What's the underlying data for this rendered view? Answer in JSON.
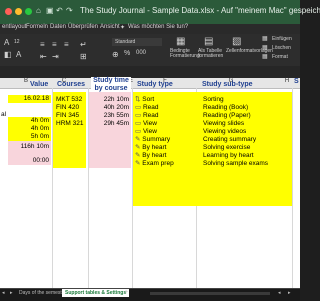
{
  "window": {
    "title": "The Study Journal - Sample Data.xlsx - Auf \"meinem Mac\" gespeichert"
  },
  "menu": [
    "entlayout",
    "Formeln",
    "Daten",
    "Überprüfen",
    "Ansicht",
    "Was möchten Sie tun?"
  ],
  "ribbon": {
    "font_size": "12",
    "number_format": "Standard",
    "conditional_label": "Bedingte Formatierung",
    "table_label": "Als Tabelle formatieren",
    "cellstyles_label": "Zellenformatvorlagen",
    "insert_label": "Einfügen",
    "delete_label": "Löschen",
    "format_label": "Format"
  },
  "columns": [
    "B",
    "C",
    "D",
    "E",
    "F",
    "G",
    "H"
  ],
  "headers": {
    "value": "Value",
    "courses": "Courses",
    "study_time": "Study time by course",
    "study_type": "Study type",
    "study_subtype": "Study sub-type",
    "s_col": "S"
  },
  "left_labels": [
    "al"
  ],
  "values": [
    "16.02.18",
    "4h 0m",
    "4h 0m",
    "5h 0m",
    "",
    "116h 10m",
    "",
    "00:00"
  ],
  "courses": [
    "MKT 532",
    "FIN 420",
    "FIN 345",
    "HRM 321"
  ],
  "study_times": [
    "22h 10m",
    "40h 20m",
    "23h 55m",
    "29h 45m"
  ],
  "study_types": [
    "Sort",
    "Read",
    "Read",
    "View",
    "View",
    "Summary",
    "By heart",
    "By heart",
    "Exam prep"
  ],
  "study_subtypes": [
    "Sorting",
    "Reading (Book)",
    "Reading (Paper)",
    "Viewing slides",
    "Viewing videos",
    "Creating summary",
    "Solving exercise",
    "Learning by heart",
    "Solving sample exams"
  ],
  "tabs": [
    "Days of the semester",
    "Support tables & Settings"
  ],
  "colors": {
    "accent_green": "#2b5a3a",
    "highlight_yellow": "#ffff00",
    "highlight_pink": "#f8d5dc",
    "header_blue": "#1f3f8f"
  }
}
